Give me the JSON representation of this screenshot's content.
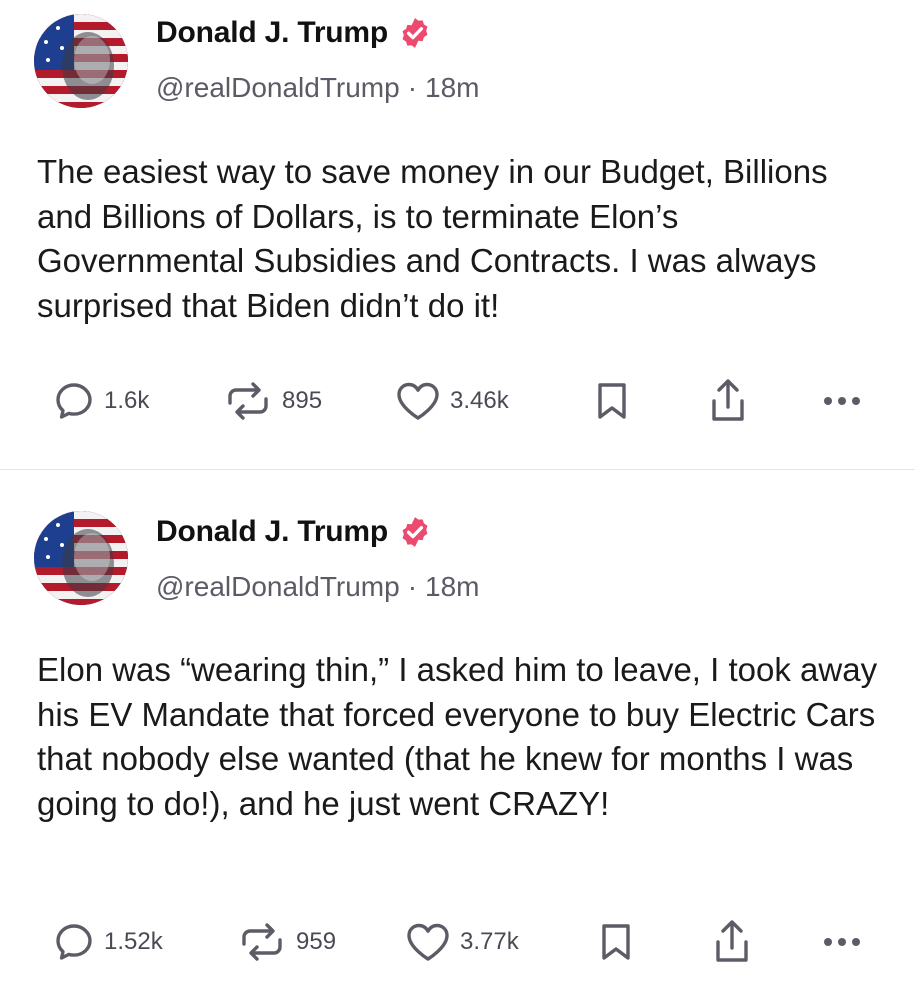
{
  "posts": [
    {
      "author": {
        "display_name": "Donald J. Trump",
        "handle": "@realDonaldTrump",
        "verified": true,
        "avatar_icon": "flag-portrait-avatar"
      },
      "separator": "·",
      "time": "18m",
      "text": "The easiest way to save money in our Budget, Billions and Billions of Dollars, is to terminate Elon’s Governmental Subsidies and Contracts. I was always surprised that Biden didn’t do it!",
      "actions": {
        "replies": "1.6k",
        "reposts": "895",
        "likes": "3.46k"
      }
    },
    {
      "author": {
        "display_name": "Donald J. Trump",
        "handle": "@realDonaldTrump",
        "verified": true,
        "avatar_icon": "flag-portrait-avatar"
      },
      "separator": "·",
      "time": "18m",
      "text": "Elon was “wearing thin,” I asked him to leave, I took away his EV Mandate that forced everyone to buy Electric Cars that nobody else wanted (that he knew for months I was going to do!), and he just went CRAZY!",
      "actions": {
        "replies": "1.52k",
        "reposts": "959",
        "likes": "3.77k"
      }
    }
  ],
  "colors": {
    "verified_badge": "#ec4a6e",
    "icon_gray": "#5c5c66",
    "divider": "#e4e4e7"
  },
  "icons": [
    "reply-icon",
    "repost-icon",
    "heart-icon",
    "bookmark-icon",
    "share-icon",
    "more-icon",
    "verified-badge-icon"
  ]
}
